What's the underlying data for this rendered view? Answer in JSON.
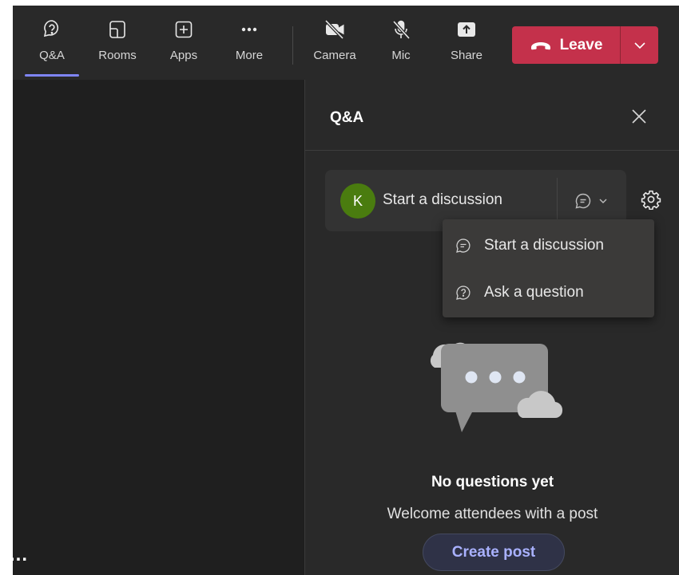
{
  "toolbar": {
    "items": [
      {
        "label": "Q&A",
        "icon": "qa-icon",
        "selected": true
      },
      {
        "label": "Rooms",
        "icon": "rooms-icon"
      },
      {
        "label": "Apps",
        "icon": "apps-plus-icon"
      },
      {
        "label": "More",
        "icon": "more-dots-icon"
      },
      {
        "label": "Camera",
        "icon": "camera-off-icon"
      },
      {
        "label": "Mic",
        "icon": "mic-off-icon"
      },
      {
        "label": "Share",
        "icon": "share-icon"
      }
    ],
    "leave_label": "Leave",
    "leave_color": "#c4314b",
    "accent": "#7f85f5"
  },
  "stage": {
    "more_label": "..."
  },
  "panel": {
    "title": "Q&A",
    "composer": {
      "avatar_initial": "K",
      "avatar_color": "#4a7c0f",
      "text": "Start a discussion"
    },
    "dropdown": [
      {
        "label": "Start a discussion",
        "icon": "discussion-icon"
      },
      {
        "label": "Ask a question",
        "icon": "question-icon"
      }
    ],
    "empty": {
      "title": "No questions yet",
      "subtitle": "Welcome attendees with a post",
      "button": "Create post"
    }
  }
}
